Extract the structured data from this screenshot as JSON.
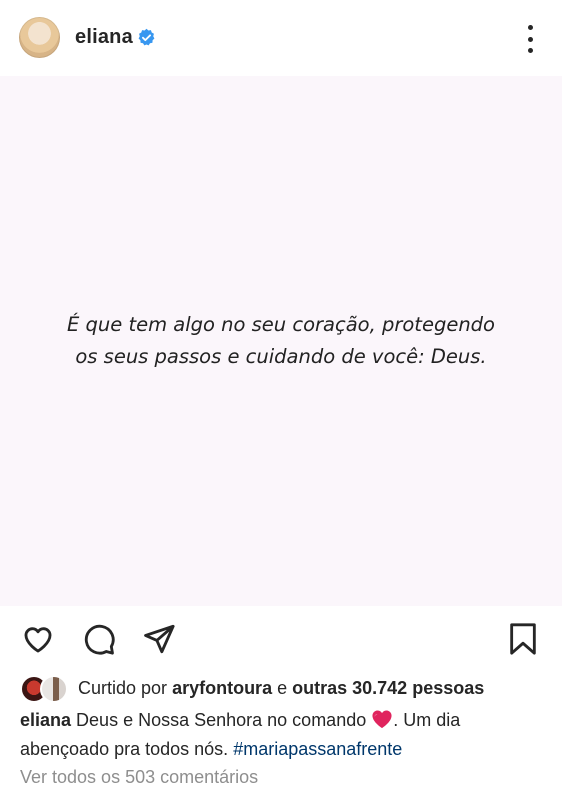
{
  "header": {
    "username": "eliana",
    "verified": true,
    "menu_icon": "more-vertical-icon"
  },
  "post": {
    "quote_line1": "É que tem algo no seu coração, protegendo",
    "quote_line2": "os seus passos e cuidando de você: Deus.",
    "background_color": "#fbf6fb"
  },
  "actions": {
    "like_icon": "heart-outline-icon",
    "comment_icon": "comment-icon",
    "share_icon": "send-icon",
    "save_icon": "bookmark-icon"
  },
  "likes": {
    "prefix": "Curtido por",
    "liker": "aryfontoura",
    "connector": "e",
    "others": "outras 30.742 pessoas"
  },
  "caption": {
    "username": "eliana",
    "text_before_emoji": "Deus e Nossa Senhora no comando",
    "emoji": "red-heart",
    "text_after_emoji": ". Um dia abençoado pra todos nós.",
    "hashtag": "#mariapassanafrente"
  },
  "comments": {
    "view_all": "Ver todos os 503 comentários"
  },
  "colors": {
    "text": "#262626",
    "muted": "#8e8e8e",
    "hashtag": "#00376b",
    "verified": "#3897f0",
    "heart": "#e0245e"
  }
}
